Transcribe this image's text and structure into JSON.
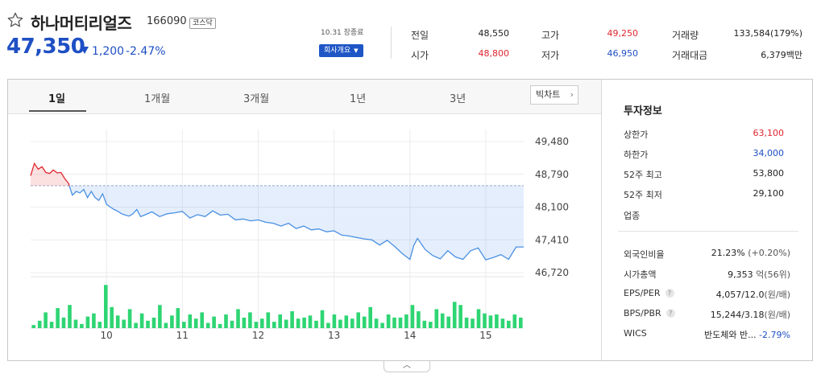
{
  "stock": {
    "name": "하나머티리얼즈",
    "code": "166090",
    "market": "코스닥",
    "price": "47,350",
    "change": "1,200",
    "change_pct": "-2.47%",
    "direction": "down"
  },
  "session": {
    "label": "10.31 장종료",
    "company_button": "회사개요"
  },
  "quote": {
    "prev_close_label": "전일",
    "prev_close": "48,550",
    "open_label": "시가",
    "open": "48,800",
    "high_label": "고가",
    "high": "49,250",
    "low_label": "저가",
    "low": "46,950",
    "volume_label": "거래량",
    "volume": "133,584(179%)",
    "amount_label": "거래대금",
    "amount": "6,379백만"
  },
  "tabs": [
    "1일",
    "1개월",
    "3개월",
    "1년",
    "3년"
  ],
  "active_tab": "1일",
  "bigchart_label": "빅차트",
  "invest": {
    "title": "투자정보",
    "upper_limit_label": "상한가",
    "upper_limit": "63,100",
    "lower_limit_label": "하한가",
    "lower_limit": "34,000",
    "high52_label": "52주 최고",
    "high52": "53,800",
    "low52_label": "52주 최저",
    "low52": "29,100",
    "industry_label": "업종",
    "foreign_label": "외국인비율",
    "foreign": "21.23%",
    "foreign_change": "(+0.20%)",
    "mktcap_label": "시가총액",
    "mktcap": "9,353",
    "mktcap_unit": "억(56위)",
    "eps_label": "EPS/PER",
    "eps": "4,057/12.0",
    "eps_unit": "(원/배)",
    "bps_label": "BPS/PBR",
    "bps": "15,244/3.18",
    "bps_unit": "(원/배)",
    "wics_label": "WICS",
    "wics": "반도체와 반...",
    "wics_change": "-2.79%"
  },
  "colors": {
    "up": "#e0262f",
    "down": "#1e4fc4",
    "volume": "#2ed573",
    "line": "#4a90e2"
  },
  "chart_data": {
    "type": "line",
    "title": "",
    "reference": 48550,
    "ylim": [
      46720,
      49480
    ],
    "y_ticks": [
      "49,480",
      "48,790",
      "48,100",
      "47,410",
      "46,720"
    ],
    "y_tick_values": [
      49480,
      48790,
      48100,
      47410,
      46720
    ],
    "x_ticks": [
      "10",
      "11",
      "12",
      "13",
      "14",
      "15"
    ],
    "x_tick_hours": [
      10,
      11,
      12,
      13,
      14,
      15
    ],
    "x_range": [
      9.0,
      15.5
    ],
    "time": [
      9.0,
      9.05,
      9.1,
      9.15,
      9.2,
      9.25,
      9.3,
      9.35,
      9.4,
      9.45,
      9.5,
      9.55,
      9.6,
      9.65,
      9.7,
      9.75,
      9.8,
      9.85,
      9.9,
      9.95,
      10.0,
      10.05,
      10.1,
      10.15,
      10.2,
      10.25,
      10.3,
      10.35,
      10.4,
      10.45,
      10.5,
      10.6,
      10.7,
      10.8,
      10.9,
      11.0,
      11.1,
      11.2,
      11.3,
      11.4,
      11.5,
      11.6,
      11.7,
      11.8,
      11.9,
      12.0,
      12.1,
      12.2,
      12.3,
      12.4,
      12.5,
      12.6,
      12.7,
      12.8,
      12.9,
      13.0,
      13.1,
      13.2,
      13.3,
      13.4,
      13.5,
      13.6,
      13.7,
      13.8,
      13.9,
      14.0,
      14.05,
      14.1,
      14.2,
      14.3,
      14.4,
      14.5,
      14.6,
      14.7,
      14.8,
      14.9,
      15.0,
      15.1,
      15.2,
      15.3,
      15.4,
      15.5
    ],
    "price": [
      48760,
      49020,
      48900,
      48950,
      48830,
      48810,
      48880,
      48820,
      48830,
      48700,
      48600,
      48350,
      48430,
      48400,
      48470,
      48300,
      48430,
      48300,
      48240,
      48380,
      48160,
      48100,
      48050,
      48010,
      47960,
      47930,
      47910,
      47960,
      48050,
      47900,
      47930,
      48000,
      47900,
      47960,
      47980,
      48010,
      47870,
      47940,
      47900,
      48020,
      47930,
      47950,
      47830,
      47850,
      47810,
      47830,
      47780,
      47760,
      47700,
      47760,
      47650,
      47700,
      47620,
      47640,
      47580,
      47600,
      47510,
      47490,
      47460,
      47430,
      47410,
      47300,
      47400,
      47270,
      47120,
      47000,
      47290,
      47440,
      47210,
      47080,
      47010,
      47180,
      47050,
      47000,
      47180,
      47240,
      46990,
      47040,
      47100,
      47000,
      47260,
      47260
    ],
    "volume": [
      6,
      14,
      30,
      12,
      38,
      20,
      44,
      16,
      8,
      22,
      28,
      12,
      82,
      40,
      24,
      16,
      36,
      10,
      28,
      14,
      20,
      44,
      10,
      24,
      38,
      12,
      26,
      18,
      30,
      10,
      22,
      8,
      26,
      14,
      36,
      20,
      30,
      12,
      18,
      30,
      12,
      26,
      16,
      32,
      18,
      20,
      24,
      14,
      34,
      10,
      26,
      16,
      24,
      18,
      30,
      22,
      40,
      18,
      10,
      26,
      20,
      20,
      26,
      44,
      32,
      14,
      12,
      36,
      28,
      22,
      50,
      44,
      20,
      18,
      36,
      28,
      24,
      26,
      18,
      14,
      26,
      20
    ],
    "volume_max": 84
  }
}
